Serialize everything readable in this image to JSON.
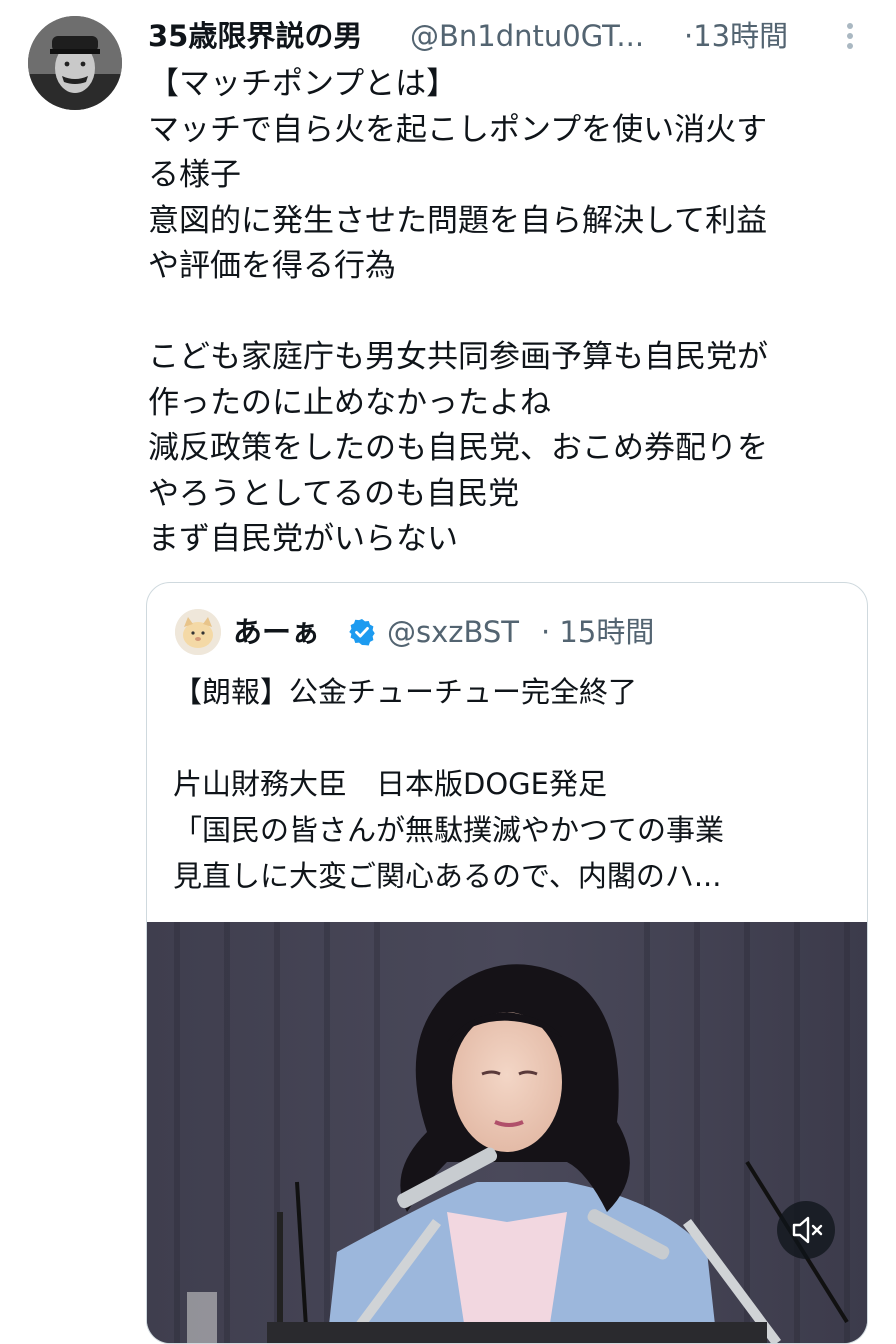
{
  "tweet": {
    "display_name": "35歳限界説の男",
    "handle": "@Bn1dntu0GT...",
    "time": "·13時間",
    "lines": [
      "【マッチポンプとは】",
      "マッチで自ら火を起こしポンプを使い消火す",
      "る様子",
      "意図的に発生させた問題を自ら解決して利益",
      "や評価を得る行為",
      "",
      "こども家庭庁も男女共同参画予算も自民党が",
      "作ったのに止めなかったよね",
      "減反政策をしたのも自民党、おこめ券配りを",
      "やろうとしてるのも自民党",
      "まず自民党がいらない"
    ]
  },
  "quote": {
    "display_name": "あーぁ",
    "handle": "@sxzBST",
    "time": "· 15時間",
    "lines": [
      "【朗報】公金チューチュー完全終了",
      "",
      "片山財務大臣　日本版DOGE発足",
      "「国民の皆さんが無駄撲滅やかつての事業",
      "見直しに大変ご関心あるので、内閣のハ..."
    ]
  },
  "icons": {
    "more": "more-vertical-icon",
    "verified": "verified-badge-icon",
    "mute": "speaker-muted-icon"
  },
  "colors": {
    "text": "#0f1419",
    "secondary": "#536471",
    "verified": "#1d9bf0",
    "border": "#cfd9de"
  }
}
